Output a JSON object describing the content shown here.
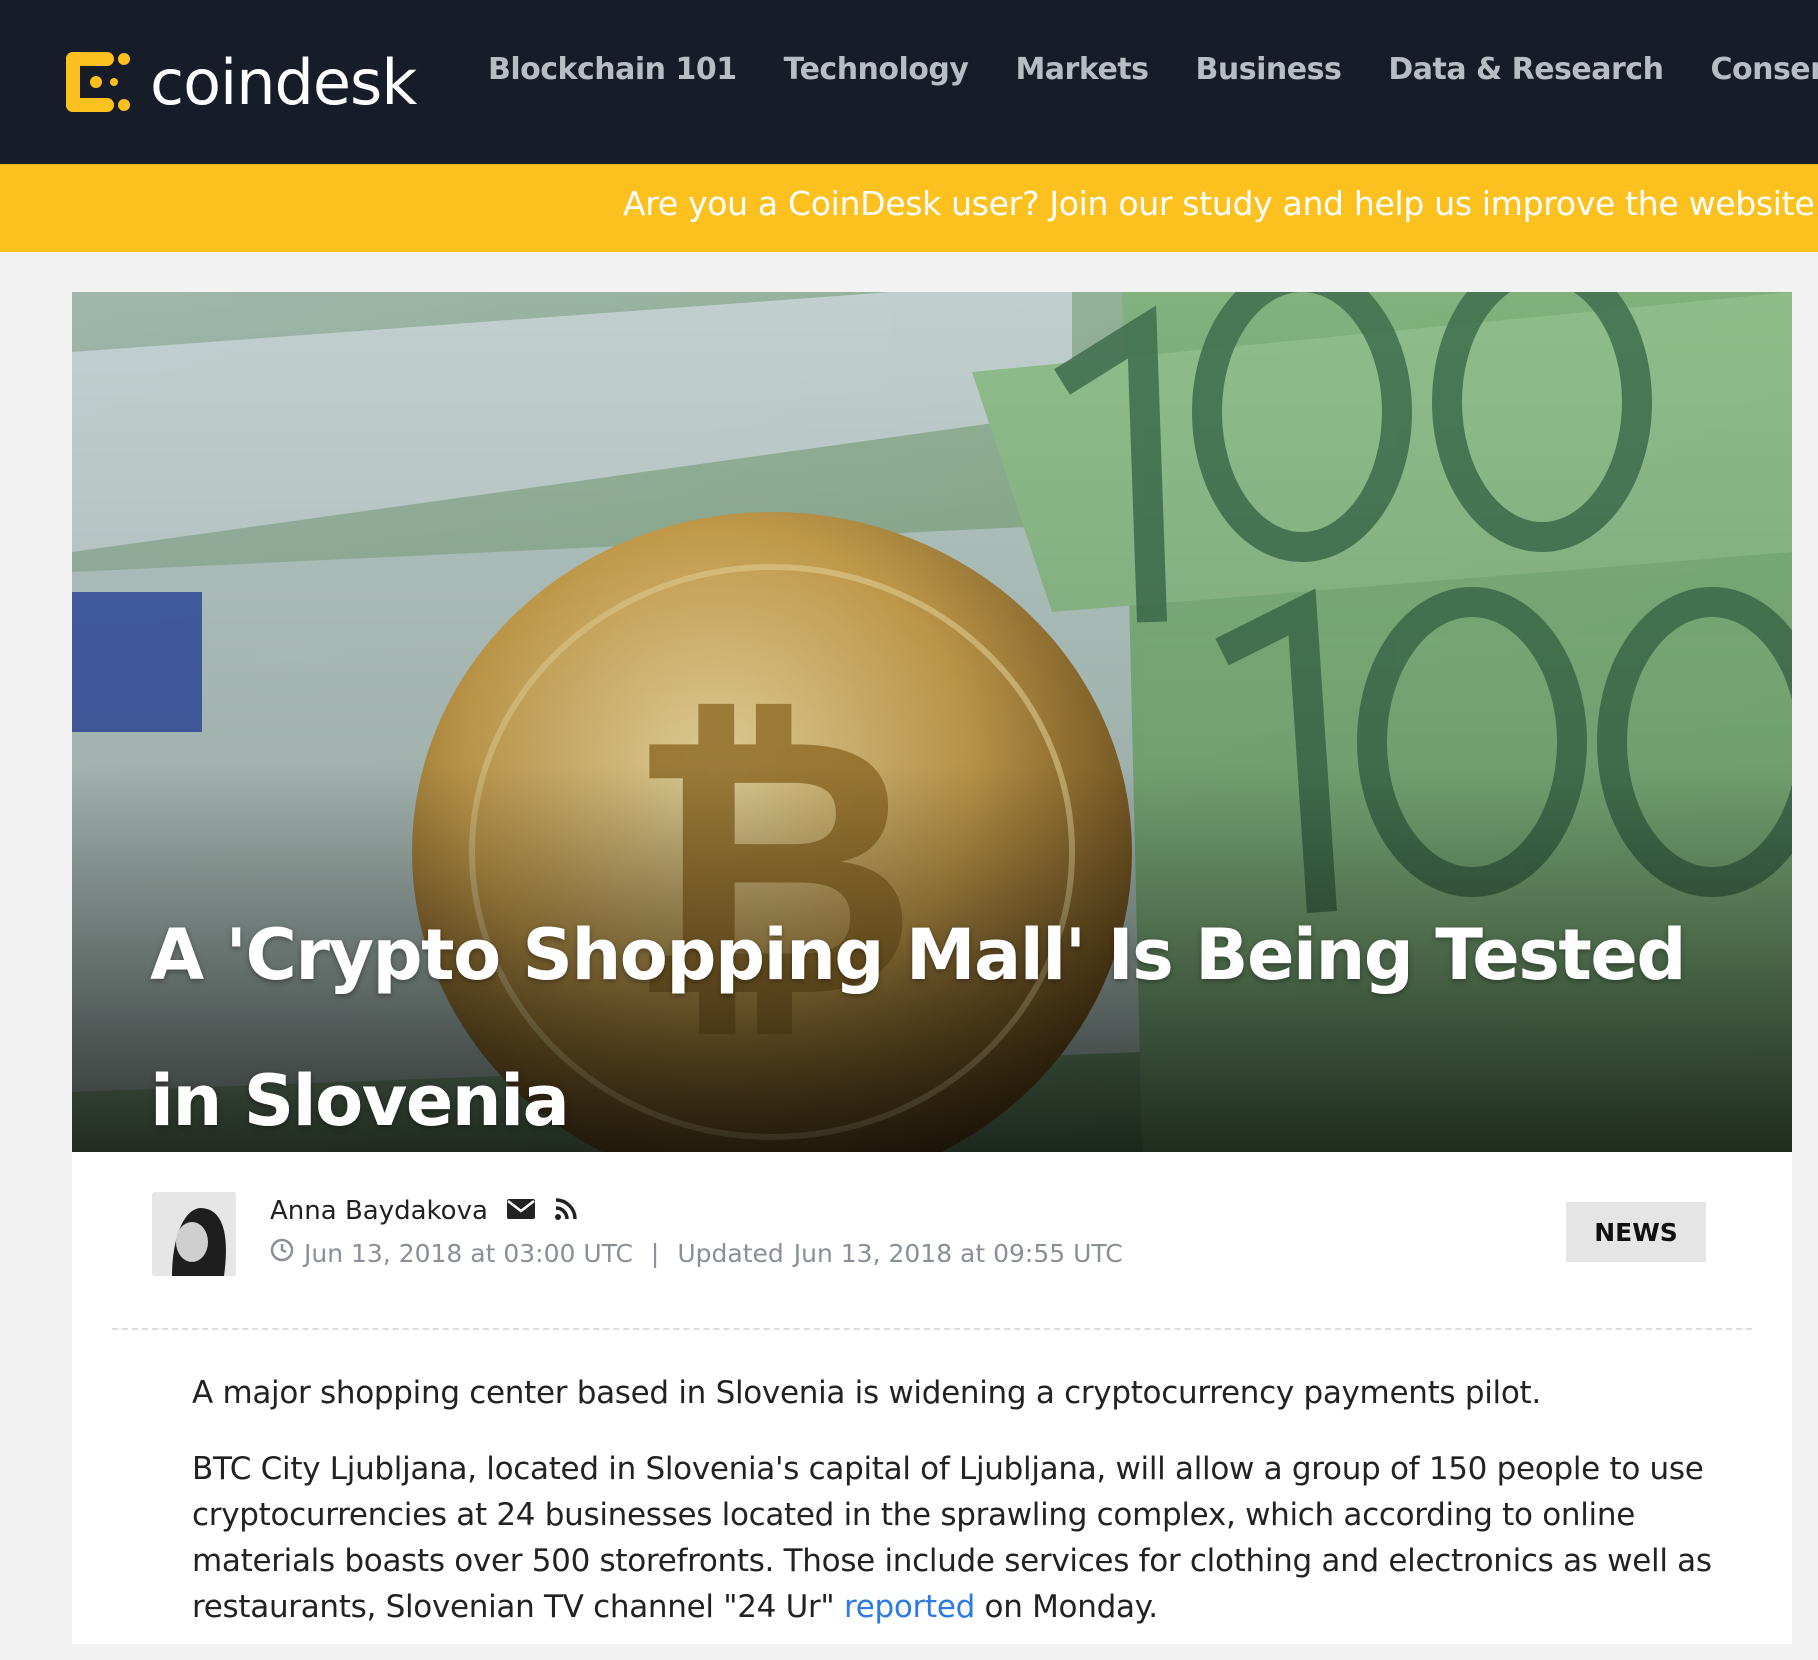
{
  "header": {
    "logo_text": "coindesk",
    "brand_color": "#fcc01f",
    "nav": [
      "Blockchain 101",
      "Technology",
      "Markets",
      "Business",
      "Data & Research",
      "Consensus"
    ]
  },
  "banner": {
    "text": "Are you a CoinDesk user? Join our study and help us improve the website by cl"
  },
  "article": {
    "title": "A 'Crypto Shopping Mall' Is Being Tested in Slovenia",
    "author": "Anna Baydakova",
    "published": "Jun 13, 2018 at 03:00 UTC",
    "separator": "|",
    "updated_label": "Updated",
    "updated": "Jun 13, 2018 at 09:55 UTC",
    "category": "NEWS",
    "paragraph1": "A major shopping center based in Slovenia is widening a cryptocurrency payments pilot.",
    "paragraph2_before": "BTC City Ljubljana, located in Slovenia's capital of Ljubljana, will allow a group of 150 people to use cryptocurrencies at 24 businesses located in the sprawling complex, which according to online materials boasts over 500 storefronts. Those include services for clothing and electronics as well as restaurants, Slovenian TV channel \"24 Ur\" ",
    "paragraph2_link": "reported",
    "paragraph2_after": " on Monday.",
    "link_color": "#2c7be5"
  },
  "icons": {
    "email": "envelope-icon",
    "rss": "rss-icon",
    "clock": "clock-icon"
  }
}
